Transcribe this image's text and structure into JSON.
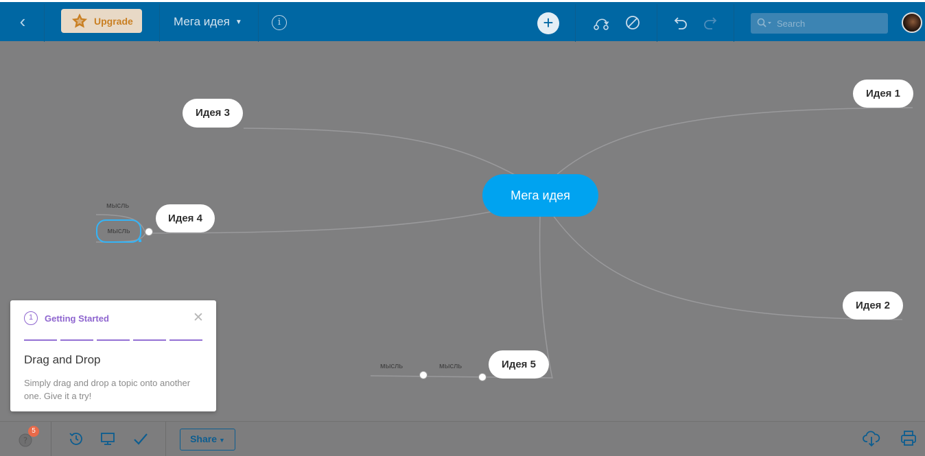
{
  "toolbar": {
    "upgrade_label": "Upgrade",
    "map_title": "Мега идея",
    "search_placeholder": "Search"
  },
  "mindmap": {
    "central": "Мега идея",
    "nodes": {
      "idea1": "Идея 1",
      "idea2": "Идея 2",
      "idea3": "Идея 3",
      "idea4": "Идея 4",
      "idea5": "Идея 5"
    },
    "thoughts": {
      "t1": "мысль",
      "t2": "мысль",
      "t3": "мысль",
      "t4": "мысль"
    }
  },
  "getting_started": {
    "step": "1",
    "title": "Getting Started",
    "heading": "Drag and Drop",
    "description": "Simply drag and drop a topic onto another one. Give it a try!"
  },
  "bottombar": {
    "help_badge": "5",
    "share_label": "Share"
  },
  "colors": {
    "topbar": "#0067a3",
    "central_node": "#00a3f0",
    "canvas": "#7f7f80",
    "accent_purple": "#8e65cf",
    "selection": "#34b4f7"
  }
}
